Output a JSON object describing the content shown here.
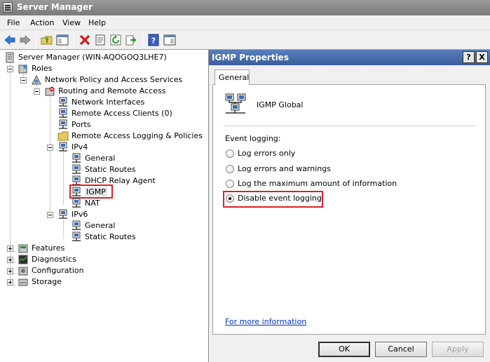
{
  "window": {
    "title": "Server Manager"
  },
  "menu": [
    "File",
    "Action",
    "View",
    "Help"
  ],
  "toolbar": {
    "buttons": [
      "back-icon",
      "forward-icon",
      "up-folder-icon",
      "show-hide-tree-icon",
      "delete-icon",
      "properties-icon",
      "refresh-icon",
      "export-list-icon",
      "help-icon",
      "show-hide-action-pane-icon"
    ]
  },
  "tree": {
    "root": "Server Manager (WIN-AQOGOQ3LHE7)",
    "roles": "Roles",
    "npas": "Network Policy and Access Services",
    "rras": "Routing and Remote Access",
    "network_interfaces": "Network Interfaces",
    "remote_access_clients": "Remote Access Clients (0)",
    "ports": "Ports",
    "remote_access_logging": "Remote Access Logging & Policies",
    "ipv4": "IPv4",
    "ipv4_general": "General",
    "ipv4_static_routes": "Static Routes",
    "dhcp_relay": "DHCP Relay Agent",
    "igmp": "IGMP",
    "nat": "NAT",
    "ipv6": "IPv6",
    "ipv6_general": "General",
    "ipv6_static_routes": "Static Routes",
    "features": "Features",
    "diagnostics": "Diagnostics",
    "configuration": "Configuration",
    "storage": "Storage"
  },
  "dialog": {
    "title": "IGMP Properties",
    "help_btn": "?",
    "close_btn": "X",
    "tab": "General",
    "header": "IGMP Global",
    "group_label": "Event logging:",
    "options": [
      {
        "label": "Log errors only",
        "selected": false
      },
      {
        "label": "Log errors and warnings",
        "selected": false
      },
      {
        "label": "Log the maximum amount of information",
        "selected": false
      },
      {
        "label": "Disable event logging",
        "selected": true
      }
    ],
    "link": "For more information",
    "ok": "OK",
    "cancel": "Cancel",
    "apply": "Apply"
  },
  "colors": {
    "highlight": "#e02020",
    "dialog_title": "#3a5e9c",
    "link": "#0033cc"
  }
}
